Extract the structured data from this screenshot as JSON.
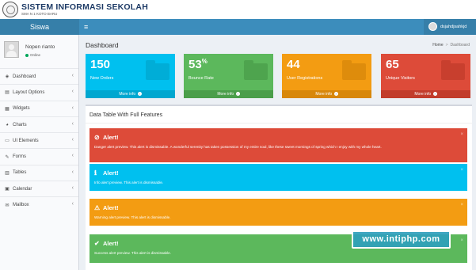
{
  "header": {
    "title": "SISTEM INFORMASI SEKOLAH",
    "subtitle": "SMA N 1 KOTO BARU"
  },
  "navbar": {
    "brand": "Siswa",
    "user_name": "dsjahdjsahkjd"
  },
  "sidebar": {
    "user": {
      "name": "Nopen rianto",
      "status": "Online"
    },
    "items": [
      {
        "label": "Dashboard",
        "icon": "dashboard-icon",
        "glyph": "◈"
      },
      {
        "label": "Layout Options",
        "icon": "files-icon",
        "glyph": "▤"
      },
      {
        "label": "Widgets",
        "icon": "th-icon",
        "glyph": "▦"
      },
      {
        "label": "Charts",
        "icon": "pie-chart-icon",
        "glyph": "◕"
      },
      {
        "label": "UI Elements",
        "icon": "laptop-icon",
        "glyph": "▭"
      },
      {
        "label": "Forms",
        "icon": "edit-icon",
        "glyph": "✎"
      },
      {
        "label": "Tables",
        "icon": "table-icon",
        "glyph": "▥"
      },
      {
        "label": "Calendar",
        "icon": "calendar-icon",
        "glyph": "▣"
      },
      {
        "label": "Mailbox",
        "icon": "envelope-icon",
        "glyph": "✉"
      }
    ]
  },
  "main": {
    "title": "Dashboard",
    "breadcrumb": {
      "home": "Home",
      "current": "Dashboard"
    },
    "stats": [
      {
        "value": "150",
        "suffix": "",
        "label": "New Orders",
        "more": "More info",
        "color": "#00c0ef",
        "dark": "#00a7d0"
      },
      {
        "value": "53",
        "suffix": "%",
        "label": "Bounce Rate",
        "more": "More info",
        "color": "#5cb85c",
        "dark": "#4a9e4a"
      },
      {
        "value": "44",
        "suffix": "",
        "label": "User Registrations",
        "more": "More info",
        "color": "#f39c12",
        "dark": "#d8870a"
      },
      {
        "value": "65",
        "suffix": "",
        "label": "Unique Visitors",
        "more": "More info",
        "color": "#dd4b39",
        "dark": "#c23c2b"
      }
    ],
    "panel_title": "Data Table With Full Features",
    "alerts": [
      {
        "type": "danger",
        "icon": "ban-icon",
        "glyph": "⊘",
        "title": "Alert!",
        "message": "Danger alert preview. This alert is dismissable. A wonderful serenity has taken possession of my entire soul, like these sweet mornings of spring which I enjoy with my whole heart.",
        "color": "#dd4b39"
      },
      {
        "type": "info",
        "icon": "info-icon",
        "glyph": "ℹ",
        "title": "Alert!",
        "message": "Info alert preview. This alert is dismissable.",
        "color": "#00c0ef"
      },
      {
        "type": "warning",
        "icon": "warning-icon",
        "glyph": "⚠",
        "title": "Alert!",
        "message": "Warning alert preview. This alert is dismissable.",
        "color": "#f39c12"
      },
      {
        "type": "success",
        "icon": "check-icon",
        "glyph": "✔",
        "title": "Alert!",
        "message": "Success alert preview. This alert is dismissable.",
        "color": "#5cb85c"
      }
    ]
  },
  "watermark": "www.intiphp.com"
}
